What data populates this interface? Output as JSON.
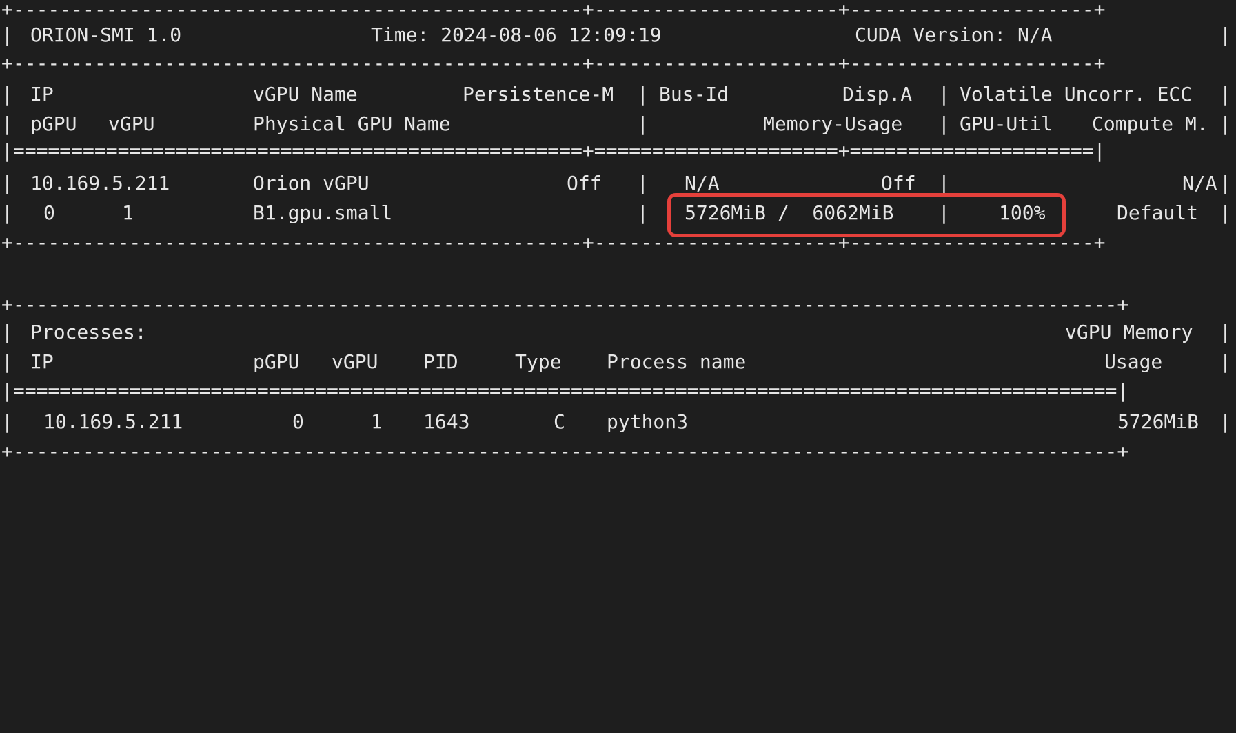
{
  "terminal": {
    "header": {
      "tool": "ORION-SMI 1.0",
      "time": "Time: 2024-08-06 12:09:19",
      "cuda": "CUDA Version: N/A"
    },
    "gpu_table": {
      "border_top": "+-------------------------------------------------+---------------------+---------------------+",
      "header_row1": {
        "ip": "IP",
        "vgpu_name": "vGPU Name",
        "persistence": "Persistence-M",
        "bus_id": "Bus-Id",
        "disp": "Disp.A",
        "ecc": "Volatile Uncorr. ECC"
      },
      "header_row2": {
        "pgpu": "pGPU",
        "vgpu": "vGPU",
        "physical_name": "Physical GPU Name",
        "memory_usage": "Memory-Usage",
        "gpu_util": "GPU-Util",
        "compute": "Compute M."
      },
      "separator": "|=================================================+=====================+=====================|",
      "rows": [
        {
          "ip": "10.169.5.211",
          "vgpu_name": "Orion vGPU",
          "persistence": "Off",
          "bus_id": "N/A",
          "disp": "Off",
          "ecc": "N/A",
          "pgpu": "0",
          "vgpu": "1",
          "physical_name": "B1.gpu.small",
          "memory_usage": "5726MiB /  6062MiB",
          "gpu_util": "100%",
          "compute": "Default"
        }
      ],
      "border_bottom": "+-------------------------------------------------+---------------------+---------------------+"
    },
    "processes_table": {
      "border_top": "+-----------------------------------------------------------------------------------------------+",
      "title": "Processes:",
      "memory_header_1": "vGPU Memory",
      "columns": {
        "ip": "IP",
        "pgpu": "pGPU",
        "vgpu": "vGPU",
        "pid": "PID",
        "type": "Type",
        "process_name": "Process name",
        "usage": "Usage"
      },
      "separator": "|===============================================================================================|",
      "rows": [
        {
          "ip": "10.169.5.211",
          "pgpu": "0",
          "vgpu": "1",
          "pid": "1643",
          "type": "C",
          "process_name": "python3",
          "usage": "5726MiB"
        }
      ],
      "border_bottom": "+-----------------------------------------------------------------------------------------------+"
    },
    "highlight_color": "#e5403b",
    "background_color": "#1e1e1e",
    "text_color": "#e6e6e6"
  }
}
